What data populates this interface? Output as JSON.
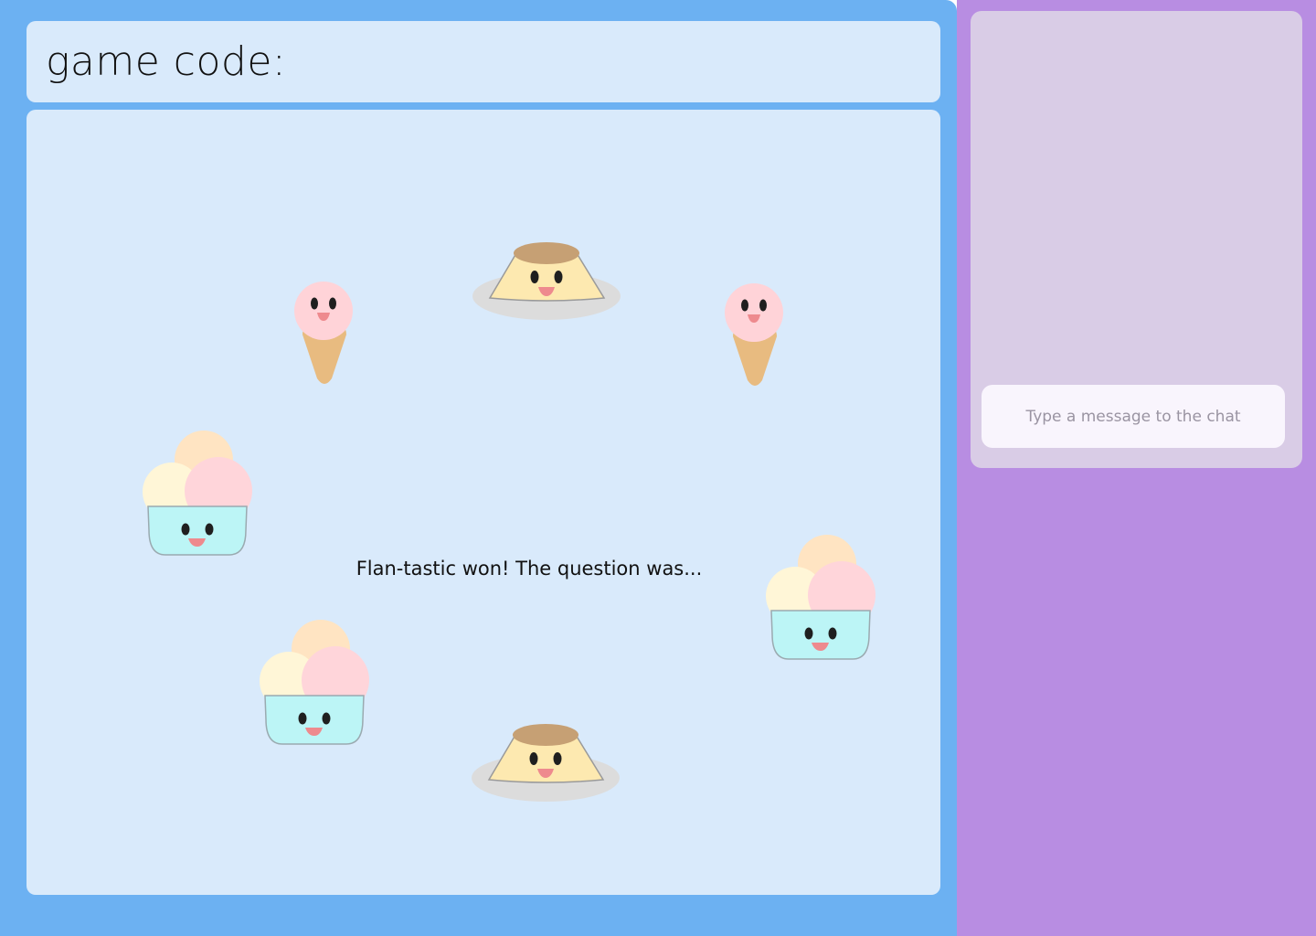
{
  "header": {
    "code_label": "game code:"
  },
  "board": {
    "status": "Flan-tastic won! The question was..."
  },
  "chat": {
    "input_placeholder": "Type a message to the chat"
  },
  "players": [
    {
      "kind": "flan-icon",
      "name": "flan-player"
    },
    {
      "kind": "ice-cream-cone-icon",
      "name": "cone-player"
    },
    {
      "kind": "ice-cream-cone-icon",
      "name": "cone-player"
    },
    {
      "kind": "ice-cream-bowl-icon",
      "name": "bowl-player"
    },
    {
      "kind": "ice-cream-bowl-icon",
      "name": "bowl-player"
    },
    {
      "kind": "ice-cream-bowl-icon",
      "name": "bowl-player"
    },
    {
      "kind": "flan-icon",
      "name": "flan-player"
    }
  ],
  "colors": {
    "game_bg": "#6cb1f2",
    "panel_bg": "#d9eafb",
    "chat_bg": "#b88de2",
    "chat_panel_bg": "#d9cce6"
  }
}
